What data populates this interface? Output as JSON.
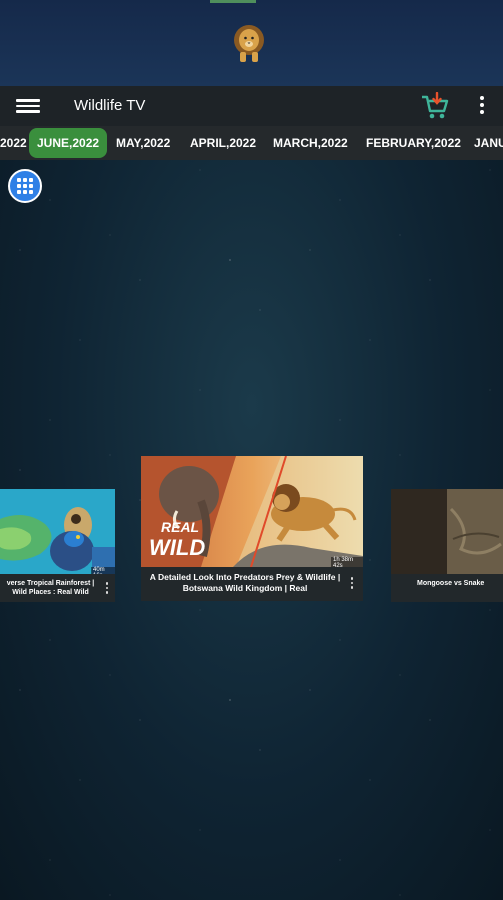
{
  "app": {
    "title": "Wildlife TV"
  },
  "header": {
    "logo_icon": "lion-logo"
  },
  "toolbar": {
    "menu_icon": "hamburger-menu-icon",
    "cart_icon": "cart-download-icon",
    "more_icon": "more-vertical-icon"
  },
  "tabs": [
    {
      "label": "2022"
    },
    {
      "label": "JUNE,2022"
    },
    {
      "label": "MAY,2022"
    },
    {
      "label": "APRIL,2022"
    },
    {
      "label": "MARCH,2022"
    },
    {
      "label": "FEBRUARY,2022"
    },
    {
      "label": "JANU"
    }
  ],
  "active_tab": 1,
  "grid_button": {
    "icon": "grid-apps-icon"
  },
  "cards": [
    {
      "caption": "verse Tropical Rainforest | Wild Places : Real Wild",
      "duration": "40m 16s"
    },
    {
      "caption": "A Detailed Look Into Predators Prey & Wildlife | Botswana Wild Kingdom | Real",
      "duration": "1h 38m 42s",
      "overlay_text_1": "REAL",
      "overlay_text_2": "WILD"
    },
    {
      "caption": "Mongoose vs Snake"
    }
  ],
  "colors": {
    "accent_green": "#3a8f3d",
    "toolbar": "#1e2327",
    "grid_button": "#2f80e6"
  }
}
